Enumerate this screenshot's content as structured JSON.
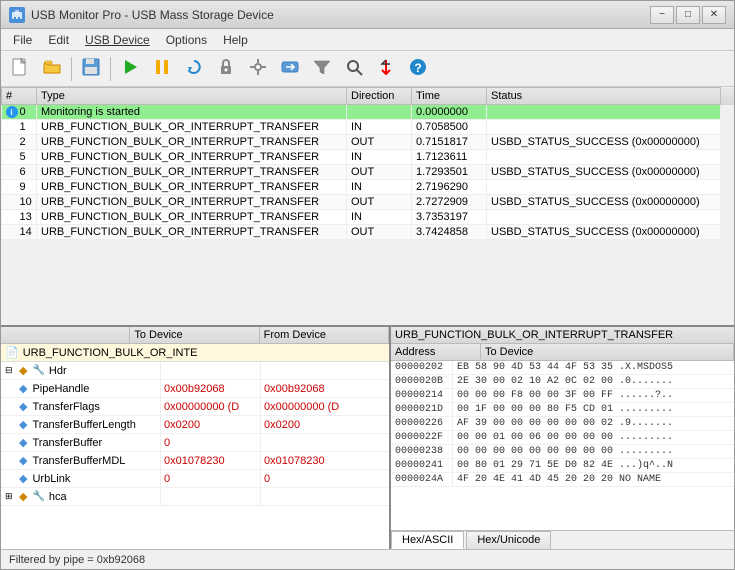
{
  "window": {
    "title": "USB Monitor Pro - USB Mass Storage Device",
    "icon": "USB"
  },
  "menu": {
    "items": [
      "File",
      "Edit",
      "USB Device",
      "Options",
      "Help"
    ]
  },
  "table": {
    "columns": [
      "#",
      "Type",
      "Direction",
      "Time",
      "Status"
    ],
    "rows": [
      {
        "num": "0",
        "type": "Monitoring is started",
        "direction": "",
        "time": "0.0000000",
        "status": "",
        "highlight": "green",
        "info": true
      },
      {
        "num": "1",
        "type": "URB_FUNCTION_BULK_OR_INTERRUPT_TRANSFER",
        "direction": "IN",
        "time": "0.7058500",
        "status": ""
      },
      {
        "num": "2",
        "type": "URB_FUNCTION_BULK_OR_INTERRUPT_TRANSFER",
        "direction": "OUT",
        "time": "0.7151817",
        "status": "USBD_STATUS_SUCCESS (0x00000000)"
      },
      {
        "num": "5",
        "type": "URB_FUNCTION_BULK_OR_INTERRUPT_TRANSFER",
        "direction": "IN",
        "time": "1.7123611",
        "status": ""
      },
      {
        "num": "6",
        "type": "URB_FUNCTION_BULK_OR_INTERRUPT_TRANSFER",
        "direction": "OUT",
        "time": "1.7293501",
        "status": "USBD_STATUS_SUCCESS (0x00000000)"
      },
      {
        "num": "9",
        "type": "URB_FUNCTION_BULK_OR_INTERRUPT_TRANSFER",
        "direction": "IN",
        "time": "2.7196290",
        "status": ""
      },
      {
        "num": "10",
        "type": "URB_FUNCTION_BULK_OR_INTERRUPT_TRANSFER",
        "direction": "OUT",
        "time": "2.7272909",
        "status": "USBD_STATUS_SUCCESS (0x00000000)"
      },
      {
        "num": "13",
        "type": "URB_FUNCTION_BULK_OR_INTERRUPT_TRANSFER",
        "direction": "IN",
        "time": "3.7353197",
        "status": ""
      },
      {
        "num": "14",
        "type": "URB_FUNCTION_BULK_OR_INTERRUPT_TRANSFER",
        "direction": "OUT",
        "time": "3.7424858",
        "status": "USBD_STATUS_SUCCESS (0x00000000)"
      }
    ]
  },
  "left_panel": {
    "headers": [
      "",
      "To Device",
      "From Device"
    ],
    "title": "URB_FUNCTION_BULK_OR_INTE",
    "tree": [
      {
        "label": "Hdr",
        "indent": 0,
        "expanded": true,
        "type": "node"
      },
      {
        "label": "PipeHandle",
        "indent": 1,
        "to": "0x00b92068",
        "from": "0x00b92068"
      },
      {
        "label": "TransferFlags",
        "indent": 1,
        "to": "0x00000000 (D",
        "from": "0x00000000 (D"
      },
      {
        "label": "TransferBufferLength",
        "indent": 1,
        "to": "0x0200",
        "from": "0x0200"
      },
      {
        "label": "TransferBuffer",
        "indent": 1,
        "to": "0",
        "from": ""
      },
      {
        "label": "TransferBufferMDL",
        "indent": 1,
        "to": "0x01078230",
        "from": "0x01078230"
      },
      {
        "label": "UrbLink",
        "indent": 1,
        "to": "0",
        "from": "0"
      },
      {
        "label": "hca",
        "indent": 0,
        "expanded": false,
        "type": "node"
      }
    ]
  },
  "right_panel": {
    "title": "URB_FUNCTION_BULK_OR_INTERRUPT_TRANSFER",
    "subheaders": [
      "Address",
      "To Device"
    ],
    "hex_rows": [
      {
        "addr": "00000202",
        "data": "EB 58 90 4D 53 44 4F 53 35 .X.MSDOS5"
      },
      {
        "addr": "0000020B",
        "data": "2E 30 00 02 10 A2 0C 02 00 .0......."
      },
      {
        "addr": "00000214",
        "data": "00 00 00 F8 00 00 3F 00 FF ......?.."
      },
      {
        "addr": "0000021D",
        "data": "00 1F 00 00 00 80 F5 CD 01 ........."
      },
      {
        "addr": "00000226",
        "data": "AF 39 00 00 00 00 00 00 02 .9......."
      },
      {
        "addr": "0000022F",
        "data": "00 00 01 00 06 00 00 00 00 ........."
      },
      {
        "addr": "00000238",
        "data": "00 00 00 00 00 00 00 00 00 ........."
      },
      {
        "addr": "00000241",
        "data": "00 80 01 29 71 5E D0 82 4E ...)q^..N"
      },
      {
        "addr": "0000024A",
        "data": "4F 20 4E 41 4D 45 20 20 20 NO NAME  "
      }
    ],
    "tabs": [
      "Hex/ASCII",
      "Hex/Unicode"
    ]
  },
  "status_bar": {
    "text": "Filtered by pipe = 0xb92068"
  },
  "labels": {
    "minimize": "−",
    "maximize": "□",
    "close": "✕"
  }
}
